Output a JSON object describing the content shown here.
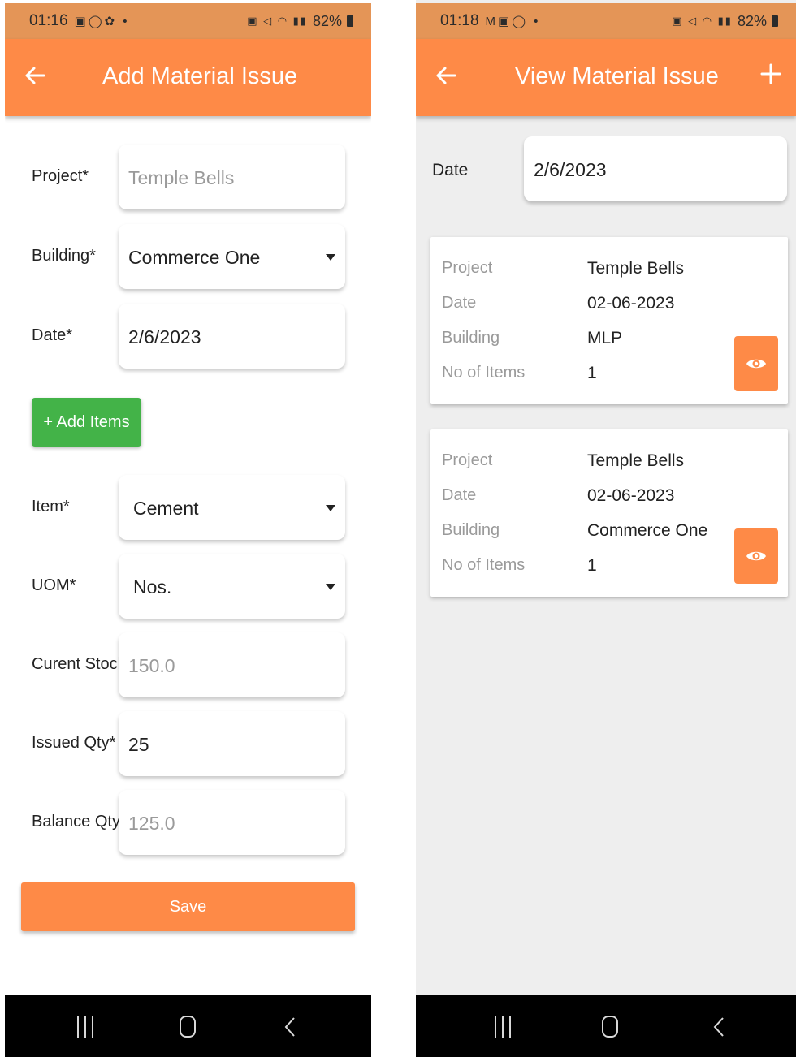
{
  "colors": {
    "accent": "#fe8a47",
    "status_bar": "#e49557",
    "add_button": "#43b348",
    "right_bg": "#eeeeee"
  },
  "add_screen": {
    "status": {
      "time": "01:16",
      "battery": "82%"
    },
    "title": "Add Material Issue",
    "fields": [
      {
        "label": "Project*",
        "value": "Temple Bells",
        "muted": true,
        "dropdown": false
      },
      {
        "label": "Building*",
        "value": "Commerce One",
        "muted": false,
        "dropdown": true
      },
      {
        "label": "Date*",
        "value": "2/6/2023",
        "muted": false,
        "dropdown": false
      }
    ],
    "add_items_label": "+ Add Items",
    "item_fields": [
      {
        "label": "Item*",
        "value": "Cement",
        "muted": false,
        "dropdown": true
      },
      {
        "label": "UOM*",
        "value": "Nos.",
        "muted": false,
        "dropdown": true
      },
      {
        "label": "Curent Stock*",
        "value": "150.0",
        "muted": true,
        "dropdown": false
      },
      {
        "label": "Issued Qty*",
        "value": "25",
        "muted": false,
        "dropdown": false
      },
      {
        "label": "Balance Qty*",
        "value": "125.0",
        "muted": true,
        "dropdown": false
      }
    ],
    "save_label": "Save"
  },
  "view_screen": {
    "status": {
      "time": "01:18",
      "battery": "82%"
    },
    "title": "View Material Issue",
    "date_label": "Date",
    "date_value": "2/6/2023",
    "card_labels": {
      "project": "Project",
      "date": "Date",
      "building": "Building",
      "items": "No of Items"
    },
    "cards": [
      {
        "project": "Temple Bells",
        "date": "02-06-2023",
        "building": "MLP",
        "items": "1"
      },
      {
        "project": "Temple Bells",
        "date": "02-06-2023",
        "building": "Commerce One",
        "items": "1"
      }
    ]
  }
}
